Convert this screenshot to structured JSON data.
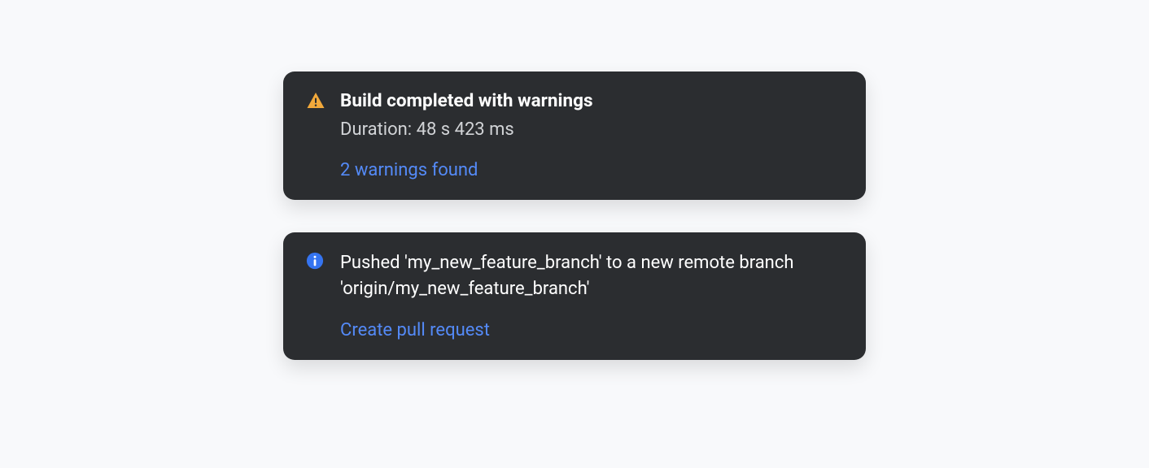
{
  "notifications": [
    {
      "icon": "warning",
      "title": "Build completed with warnings",
      "subtitle": "Duration: 48 s 423 ms",
      "link": "2 warnings found"
    },
    {
      "icon": "info",
      "body": "Pushed 'my_new_feature_branch' to a new remote branch 'origin/my_new_feature_branch'",
      "link": "Create pull request"
    }
  ],
  "colors": {
    "card_bg": "#2b2d30",
    "page_bg": "#f8f9fb",
    "link": "#548af7",
    "warning": "#f2a93b",
    "info": "#3574f0"
  }
}
